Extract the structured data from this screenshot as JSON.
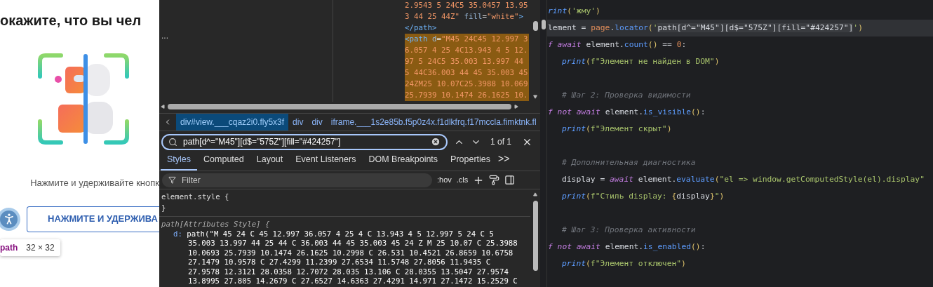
{
  "page": {
    "heading": "окажите, что вы чел",
    "instruction": "Нажмите и удерживайте кнопк",
    "button": "НАЖМИТЕ И УДЕРЖИВА",
    "tooltip": {
      "tag": "path",
      "size": "32 × 32"
    }
  },
  "devtools": {
    "ellipsis": "...",
    "dom_lines": [
      {
        "selected": false,
        "tokens": [
          {
            "kind": "string",
            "text": "2.9543 5 24C5 35.0457 13.95"
          }
        ]
      },
      {
        "selected": false,
        "tokens": [
          {
            "kind": "string",
            "text": "3 44 25 44Z\""
          },
          {
            "kind": "attr",
            "text": " fill"
          },
          {
            "kind": "punct",
            "text": "="
          },
          {
            "kind": "string",
            "text": "\"white\""
          },
          {
            "kind": "tag",
            "text": ">"
          }
        ]
      },
      {
        "selected": false,
        "tokens": [
          {
            "kind": "tag",
            "text": "</path>"
          }
        ]
      },
      {
        "selected": true,
        "tokens": [
          {
            "kind": "tag",
            "text": "<path"
          },
          {
            "kind": "attr",
            "text": " d"
          },
          {
            "kind": "punct",
            "text": "="
          },
          {
            "kind": "string",
            "text": "\"M45 24C45 12.997 3"
          }
        ]
      },
      {
        "selected": true,
        "tokens": [
          {
            "kind": "string",
            "text": "6.057 4 25 4C13.943 4 5 12."
          }
        ]
      },
      {
        "selected": true,
        "tokens": [
          {
            "kind": "string",
            "text": "97 5 24C5 35.003 13.997 44"
          }
        ]
      },
      {
        "selected": true,
        "tokens": [
          {
            "kind": "string",
            "text": "5 44C36.003 44 45 35.003 45"
          }
        ]
      },
      {
        "selected": true,
        "tokens": [
          {
            "kind": "string",
            "text": "24ZM25 10.07C25.3988 10.069"
          }
        ]
      },
      {
        "selected": true,
        "tokens": [
          {
            "kind": "string",
            "text": "25.7939 10.1474 26.1625 10."
          }
        ]
      }
    ],
    "breadcrumbs": [
      {
        "label": "div#view.___cqaz2i0.fly5x3f",
        "selected": true
      },
      {
        "label": "div",
        "selected": false
      },
      {
        "label": "div",
        "selected": false
      },
      {
        "label": "iframe.___1s2e85b.f5p0z4x.f1dlkfrq.f17mccla.fimktnk.fl",
        "selected": false
      }
    ],
    "search": {
      "value": "path[d^=\"M45\"][d$=\"575Z\"][fill=\"#424257\"]",
      "count": "1 of 1"
    },
    "tabs": [
      {
        "label": "Styles",
        "selected": true
      },
      {
        "label": "Computed",
        "selected": false
      },
      {
        "label": "Layout",
        "selected": false
      },
      {
        "label": "Event Listeners",
        "selected": false
      },
      {
        "label": "DOM Breakpoints",
        "selected": false
      },
      {
        "label": "Properties",
        "selected": false
      }
    ],
    "more_tabs": ">>",
    "filter": {
      "placeholder": "Filter"
    },
    "hov": ":hov",
    "cls": ".cls",
    "style_lines": [
      {
        "kind": "plain",
        "text": "element.style {"
      },
      {
        "kind": "plain",
        "text": "}"
      },
      {
        "kind": "selector",
        "text": "path[Attributes Style] {"
      },
      {
        "kind": "property",
        "name": "d:",
        "text": "path(\"M 45 24 C 45 12.997 36.057 4 25 4 C 13.943 4 5 12.997 5 24 C 5"
      },
      {
        "kind": "value",
        "text": "35.003 13.997 44 25 44 C 36.003 44 45 35.003 45 24 Z M 25 10.07 C 25.3988"
      },
      {
        "kind": "value",
        "text": "10.0693 25.7939 10.1474 26.1625 10.2998 C 26.531 10.4521 26.8659 10.6758"
      },
      {
        "kind": "value",
        "text": "27.1479 10.9578 C 27.4299 11.2399 27.6534 11.5748 27.8056 11.9435 C"
      },
      {
        "kind": "value",
        "text": "27.9578 12.3121 28.0358 12.7072 28.035 13.106 C 28.0355 13.5047 27.9574"
      },
      {
        "kind": "value",
        "text": "13.8995 27.805 14.2679 C 27.6527 14.6363 27.4291 14.971 27.1472 15.2529 C"
      }
    ]
  },
  "editor": {
    "lines": [
      {
        "indented": false,
        "current": false,
        "tokens": [
          {
            "kind": "func",
            "text": "rint"
          },
          {
            "kind": "paren",
            "text": "("
          },
          {
            "kind": "string",
            "text": "'жму'"
          },
          {
            "kind": "paren",
            "text": ")"
          }
        ]
      },
      {
        "indented": false,
        "current": true,
        "tokens": [
          {
            "kind": "plain",
            "text": "lement = "
          },
          {
            "kind": "var",
            "text": "page"
          },
          {
            "kind": "plain",
            "text": "."
          },
          {
            "kind": "method",
            "text": "locator"
          },
          {
            "kind": "paren",
            "text": "("
          },
          {
            "kind": "string",
            "text": "'"
          },
          {
            "kind": "selection",
            "text": "path[d^=\"M45\"][d$=\"575Z\"][fill=\"#424257\"]"
          },
          {
            "kind": "string",
            "text": "'"
          },
          {
            "kind": "paren",
            "text": ")"
          }
        ]
      },
      {
        "indented": false,
        "current": false,
        "tokens": [
          {
            "kind": "keyword",
            "text": "f await"
          },
          {
            "kind": "plain",
            "text": " element."
          },
          {
            "kind": "method",
            "text": "count"
          },
          {
            "kind": "paren",
            "text": "()"
          },
          {
            "kind": "plain",
            "text": " == "
          },
          {
            "kind": "number",
            "text": "0"
          },
          {
            "kind": "plain",
            "text": ":"
          }
        ]
      },
      {
        "indented": true,
        "current": false,
        "tokens": [
          {
            "kind": "func",
            "text": "print"
          },
          {
            "kind": "paren",
            "text": "("
          },
          {
            "kind": "string",
            "text": "f\"Элемент не найден в DOM\""
          },
          {
            "kind": "paren",
            "text": ")"
          }
        ]
      },
      {
        "kind": "blank"
      },
      {
        "indented": true,
        "current": false,
        "tokens": [
          {
            "kind": "comment",
            "text": "# Шаг 2: Проверка видимости"
          }
        ]
      },
      {
        "indented": false,
        "current": false,
        "tokens": [
          {
            "kind": "keyword",
            "text": "f not await"
          },
          {
            "kind": "plain",
            "text": " element."
          },
          {
            "kind": "method",
            "text": "is_visible"
          },
          {
            "kind": "paren",
            "text": "()"
          },
          {
            "kind": "plain",
            "text": ":"
          }
        ]
      },
      {
        "indented": true,
        "current": false,
        "tokens": [
          {
            "kind": "func",
            "text": "print"
          },
          {
            "kind": "paren",
            "text": "("
          },
          {
            "kind": "string",
            "text": "f\"Элемент скрыт\""
          },
          {
            "kind": "paren",
            "text": ")"
          }
        ]
      },
      {
        "kind": "blank"
      },
      {
        "indented": true,
        "current": false,
        "tokens": [
          {
            "kind": "comment",
            "text": "# Дополнительная диагностика"
          }
        ]
      },
      {
        "indented": true,
        "current": false,
        "tokens": [
          {
            "kind": "plain",
            "text": "display = "
          },
          {
            "kind": "keyword",
            "text": "await"
          },
          {
            "kind": "plain",
            "text": " element."
          },
          {
            "kind": "method",
            "text": "evaluate"
          },
          {
            "kind": "paren",
            "text": "("
          },
          {
            "kind": "string",
            "text": "\"el => window.getComputedStyle(el).display\""
          }
        ]
      },
      {
        "indented": true,
        "current": false,
        "tokens": [
          {
            "kind": "func",
            "text": "print"
          },
          {
            "kind": "paren",
            "text": "("
          },
          {
            "kind": "string",
            "text": "f\"Стиль display: "
          },
          {
            "kind": "paren",
            "text": "{"
          },
          {
            "kind": "plain",
            "text": "display"
          },
          {
            "kind": "paren",
            "text": "}"
          },
          {
            "kind": "string",
            "text": "\""
          },
          {
            "kind": "paren",
            "text": ")"
          }
        ]
      },
      {
        "kind": "blank"
      },
      {
        "indented": true,
        "current": false,
        "tokens": [
          {
            "kind": "comment",
            "text": "# Шаг 3: Проверка активности"
          }
        ]
      },
      {
        "indented": false,
        "current": false,
        "tokens": [
          {
            "kind": "keyword",
            "text": "f not await"
          },
          {
            "kind": "plain",
            "text": " element."
          },
          {
            "kind": "method",
            "text": "is_enabled"
          },
          {
            "kind": "paren",
            "text": "()"
          },
          {
            "kind": "plain",
            "text": ":"
          }
        ]
      },
      {
        "indented": true,
        "current": false,
        "tokens": [
          {
            "kind": "func",
            "text": "print"
          },
          {
            "kind": "paren",
            "text": "("
          },
          {
            "kind": "string",
            "text": "f\"Элемент отключен\""
          },
          {
            "kind": "paren",
            "text": ")"
          }
        ]
      }
    ]
  }
}
